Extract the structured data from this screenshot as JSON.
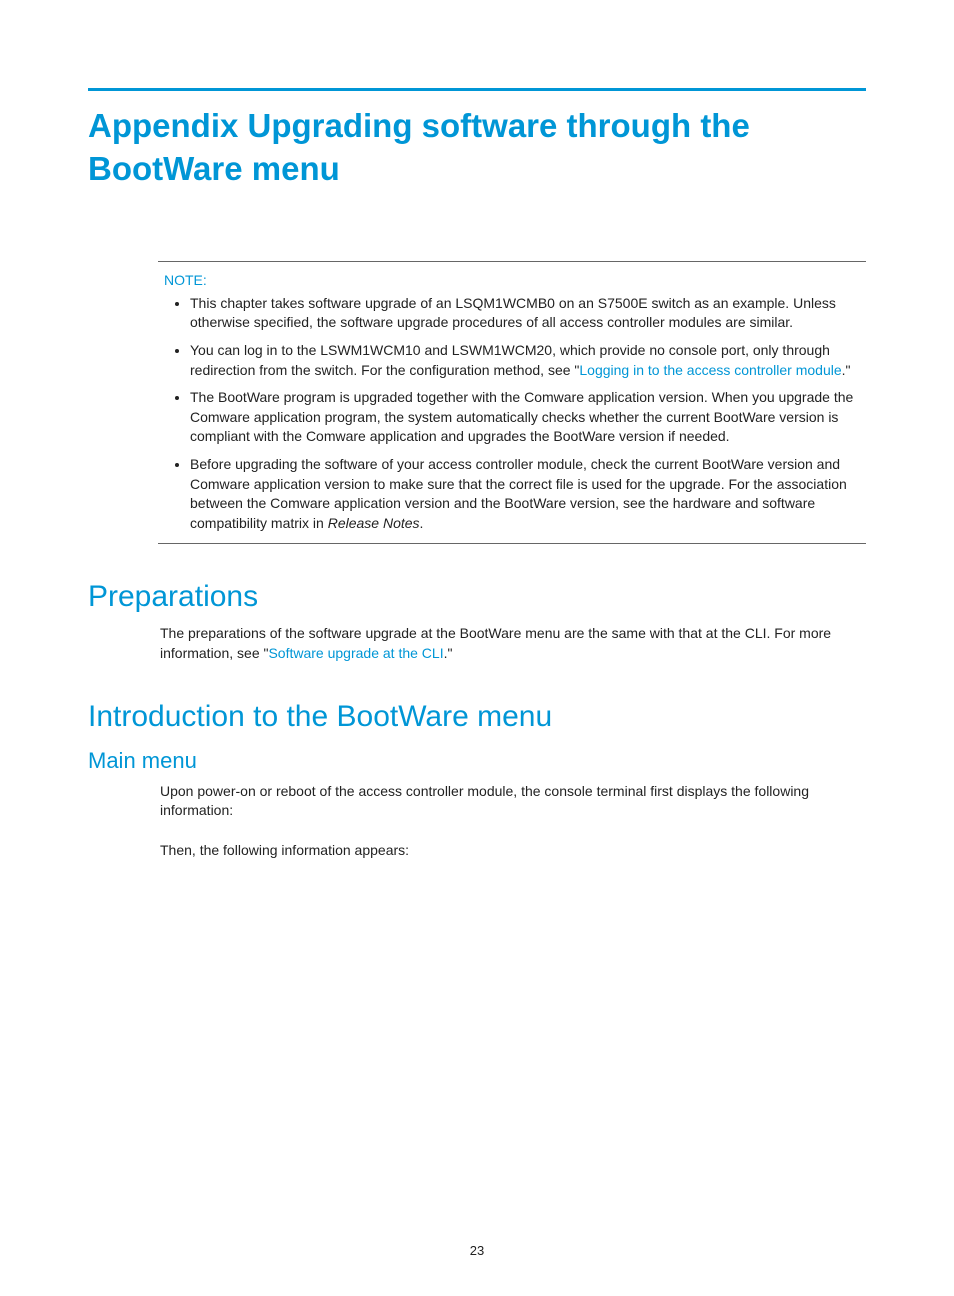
{
  "pageNumber": "23",
  "title": "Appendix Upgrading software through the BootWare menu",
  "note": {
    "label": "NOTE:",
    "items": [
      {
        "text_a": "This chapter takes software upgrade of an LSQM1WCMB0 on an S7500E switch as an example. Unless otherwise specified, the software upgrade procedures of all access controller modules are similar."
      },
      {
        "text_a": "You can log in to the LSWM1WCM10 and LSWM1WCM20, which provide no console port, only through redirection from the switch. For the configuration method, see \"",
        "link": "Logging in to the access controller module",
        "text_b": ".\""
      },
      {
        "text_a": "The BootWare program is upgraded together with the Comware application version. When you upgrade the Comware application program, the system automatically checks whether the current BootWare version is compliant with the Comware application and upgrades the BootWare version if needed."
      },
      {
        "text_a": "Before upgrading the software of your access controller module, check the current BootWare version and Comware application version to make sure that the correct file is used for the upgrade. For the association between the Comware application version and the BootWare version, see the hardware and software compatibility matrix in ",
        "ital": "Release Notes",
        "text_b": "."
      }
    ]
  },
  "sections": {
    "prep": {
      "heading": "Preparations",
      "para_a": "The preparations of the software upgrade at the BootWare menu are the same with that at the CLI. For more information, see \"",
      "link": "Software upgrade at the CLI",
      "para_b": ".\""
    },
    "intro": {
      "heading": "Introduction to the BootWare menu",
      "sub": {
        "heading": "Main menu",
        "para1": "Upon power-on or reboot of the access controller module, the console terminal first displays the following information:",
        "para2": "Then, the following information appears:"
      }
    }
  }
}
